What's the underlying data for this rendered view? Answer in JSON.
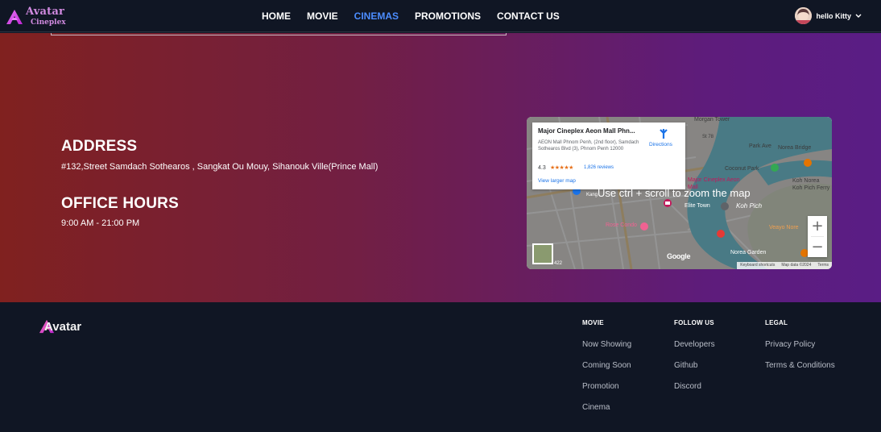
{
  "nav": {
    "brand_title": "Avatar",
    "brand_sub": "Cineplex",
    "links": [
      "HOME",
      "MOVIE",
      "CINEMAS",
      "PROMOTIONS",
      "CONTACT US"
    ],
    "active": "CINEMAS",
    "user_name": "hello Kitty"
  },
  "hero": {
    "address_heading": "ADDRESS",
    "address_text": "#132,Street Samdach Sothearos , Sangkat Ou Mouy, Sihanouk Ville(Prince Mall)",
    "hours_heading": "OFFICE HOURS",
    "hours_text": "9:00 AM - 21:00 PM"
  },
  "map": {
    "place_name": "Major Cineplex Aeon Mall Phn...",
    "place_address": "AEON Mall Phnom Penh, (2nd floor), Samdach Sothearos Blvd (3), Phnom Penh 12000",
    "rating": "4.3",
    "stars": "★★★★★",
    "reviews": "1,826 reviews",
    "view_larger": "View larger map",
    "directions": "Directions",
    "hint": "Use ctrl + scroll to zoom the map",
    "zoom_in": "+",
    "zoom_out": "−",
    "google": "Google",
    "footer_links": [
      "Keyboard shortcuts",
      "Map data ©2024",
      "Terms"
    ],
    "labels": {
      "morgan_tower": "Morgan Tower",
      "park_ave": "Park Ave",
      "norea_bridge": "Norea Bridge",
      "coconut_park": "Coconut Park",
      "major_cineplex": "Major Cineplex Aeon",
      "mall": "Mall",
      "koh_norea": "Koh Norea",
      "koh_pich_ferry": "Koh Pich Ferry",
      "elite_town": "Elite Town",
      "koh_pich": "Koh Pich",
      "rose_condo": "Rose Condo",
      "veayo_nore": "Veayo Nore",
      "norea_garden": "Norea Garden",
      "st_78": "St 78",
      "kang": "Kang",
      "num_422": "422"
    }
  },
  "footer": {
    "brand": "Avatar",
    "columns": [
      {
        "heading": "MOVIE",
        "items": [
          "Now Showing",
          "Coming Soon",
          "Promotion",
          "Cinema"
        ]
      },
      {
        "heading": "FOLLOW US",
        "items": [
          "Developers",
          "Github",
          "Discord"
        ]
      },
      {
        "heading": "LEGAL",
        "items": [
          "Privacy Policy",
          "Terms & Conditions"
        ]
      }
    ]
  },
  "colors": {
    "accent_blue": "#4c8dff",
    "brand_pink": "#d18ae0",
    "footer_bg": "#101624"
  }
}
